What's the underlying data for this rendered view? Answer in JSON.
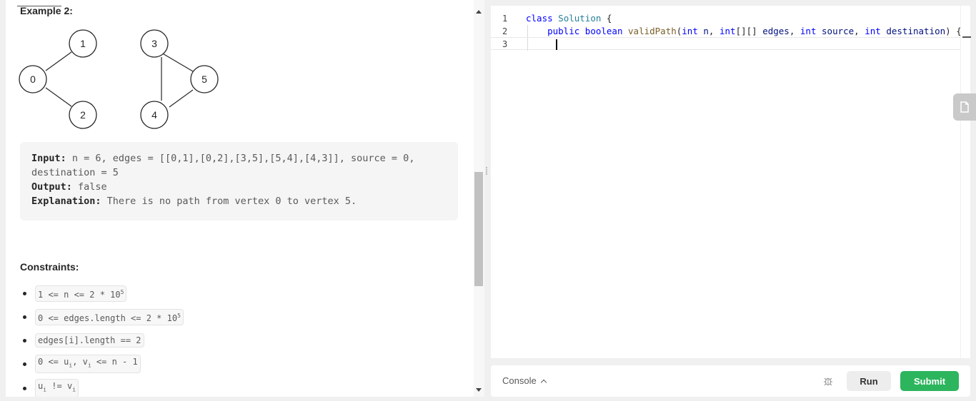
{
  "problem": {
    "example_title": "Example 2:",
    "graph": {
      "nodes": [
        "0",
        "1",
        "2",
        "3",
        "4",
        "5"
      ],
      "edges": [
        [
          "0",
          "1"
        ],
        [
          "0",
          "2"
        ],
        [
          "3",
          "5"
        ],
        [
          "5",
          "4"
        ],
        [
          "4",
          "3"
        ]
      ]
    },
    "example": {
      "input_label": "Input:",
      "input_text": " n = 6, edges = [[0,1],[0,2],[3,5],[5,4],[4,3]], source = 0,",
      "input_text_cont": "destination = 5",
      "output_label": "Output:",
      "output_text": " false",
      "explanation_label": "Explanation:",
      "explanation_text": " There is no path from vertex 0 to vertex 5."
    },
    "constraints_title": "Constraints:",
    "constraints": [
      {
        "main": "1 <= n <= 2 * 10",
        "sup": "5"
      },
      {
        "main": "0 <= edges.length <= 2 * 10",
        "sup": "5"
      },
      {
        "main": "edges[i].length == 2"
      },
      {
        "main": "0 <= u",
        "sub1": "i",
        "mid": ", v",
        "sub2": "i",
        "tail": " <= n - 1"
      },
      {
        "main": "u",
        "sub1": "i",
        "mid": " != v",
        "sub2": "i"
      }
    ]
  },
  "editor": {
    "line_numbers": [
      "1",
      "2",
      "3"
    ],
    "line1": {
      "kw": "class",
      "cls": "Solution",
      "rest": " {"
    },
    "line2": {
      "indent": "    ",
      "kw_public": "public",
      "kw_boolean": "boolean",
      "fn": "validPath",
      "p1_type": "int",
      "p1_name": "n",
      "p2_type": "int",
      "p2_brackets": "[][]",
      "p2_name": "edges",
      "p3_type": "int",
      "p3_name": "source",
      "p4_type": "int",
      "p4_name": "destination",
      "tail": ") {"
    }
  },
  "console": {
    "label": "Console",
    "run_label": "Run",
    "submit_label": "Submit"
  },
  "colors": {
    "submit": "#2db55d",
    "keyword": "#0000ff",
    "type": "#267f99"
  }
}
